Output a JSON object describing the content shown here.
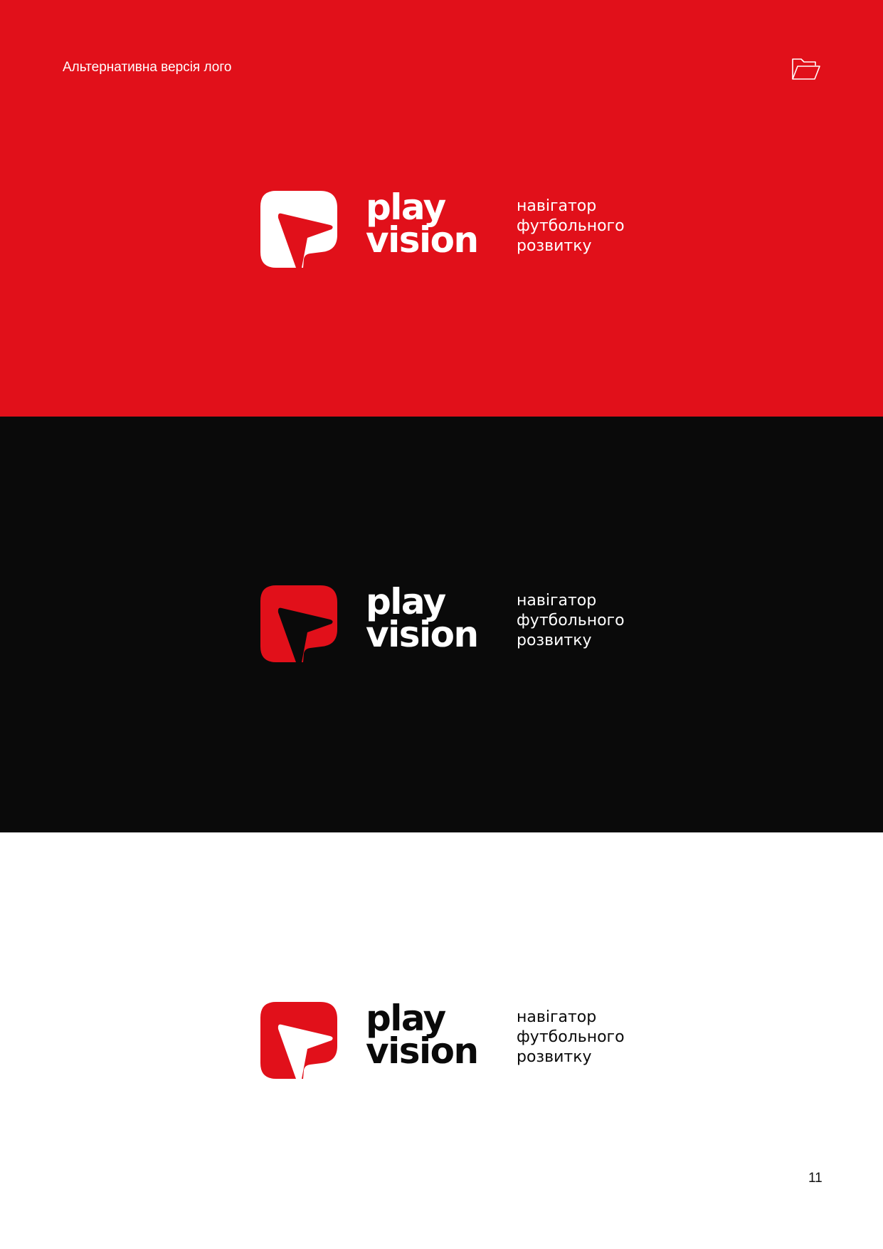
{
  "header": {
    "title": "Альтернативна версія лого",
    "icon": "folder-open-icon"
  },
  "logos": [
    {
      "background": "#e1101a",
      "mark_color": "#ffffff",
      "text_color": "#ffffff",
      "wordmark": {
        "line1": "play",
        "line2": "vision"
      },
      "tagline": {
        "line1": "навігатор",
        "line2": "футбольного",
        "line3": "розвитку"
      }
    },
    {
      "background": "#0a0a0a",
      "mark_color": "#e1101a",
      "text_color": "#ffffff",
      "wordmark": {
        "line1": "play",
        "line2": "vision"
      },
      "tagline": {
        "line1": "навігатор",
        "line2": "футбольного",
        "line3": "розвитку"
      }
    },
    {
      "background": "#ffffff",
      "mark_color": "#e1101a",
      "text_color": "#0a0a0a",
      "wordmark": {
        "line1": "play",
        "line2": "vision"
      },
      "tagline": {
        "line1": "навігатор",
        "line2": "футбольного",
        "line3": "розвитку"
      }
    }
  ],
  "footer": {
    "page_number": "11"
  }
}
